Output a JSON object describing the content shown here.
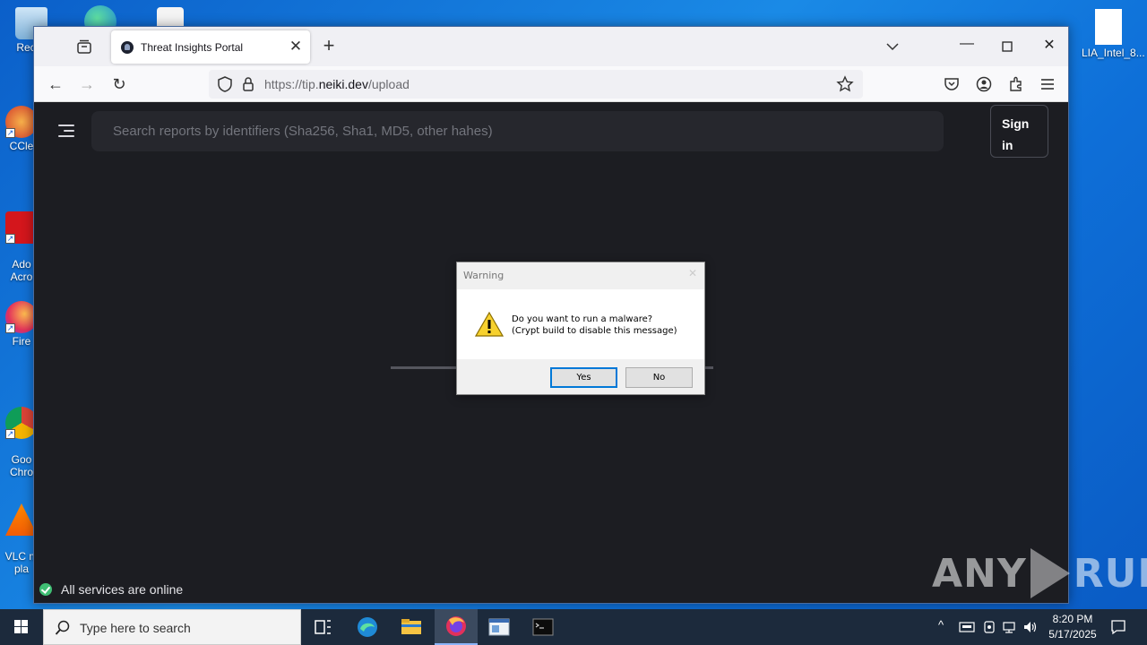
{
  "desktop": {
    "icons_left": [
      {
        "label": "Recyc",
        "name": "recycle-bin"
      },
      {
        "label": "CCle",
        "name": "ccleaner"
      },
      {
        "label": "Ado\nAcro",
        "name": "adobe-acrobat"
      },
      {
        "label": "Fire",
        "name": "firefox"
      },
      {
        "label": "Goo\nChro",
        "name": "google-chrome"
      },
      {
        "label": "VLC m\npla",
        "name": "vlc-player"
      }
    ],
    "file_icon_label": "LIA_Intel_8..."
  },
  "browser": {
    "tab_title": "Threat Insights Portal",
    "url_host": "https://tip.",
    "url_domain": "neiki.dev",
    "url_path": "/upload"
  },
  "page": {
    "search_placeholder": "Search reports by identifiers (Sha256, Sha1, MD5, other hahes)",
    "signin_label": "Sign in",
    "status_text": "All services are online"
  },
  "dialog": {
    "title": "Warning",
    "message_line1": "Do you want to run a malware?",
    "message_line2": "(Crypt build to disable this message)",
    "yes_label": "Yes",
    "no_label": "No"
  },
  "watermark": {
    "left": "ANY",
    "right": "RUN"
  },
  "taskbar": {
    "search_placeholder": "Type here to search",
    "time": "8:20 PM",
    "date": "5/17/2025"
  }
}
